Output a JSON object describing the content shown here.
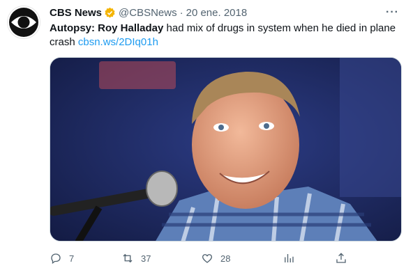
{
  "tweet": {
    "author_name": "CBS News",
    "handle": "@CBSNews",
    "separator": "·",
    "date": "20 ene. 2018",
    "more_label": "···",
    "text_bold": "Autopsy: Roy Halladay",
    "text_rest": " had mix of drugs in system when he died in plane crash ",
    "link": "cbsn.ws/2DIq01h"
  },
  "actions": {
    "replies": "7",
    "retweets": "37",
    "likes": "28"
  },
  "colors": {
    "link": "#1d9bf0",
    "verified": "#f4b400",
    "secondary_text": "#536471"
  },
  "icons": [
    "cbs-eye-logo-icon",
    "verified-badge-icon",
    "more-options-icon",
    "reply-icon",
    "retweet-icon",
    "like-icon",
    "views-icon",
    "share-icon"
  ]
}
